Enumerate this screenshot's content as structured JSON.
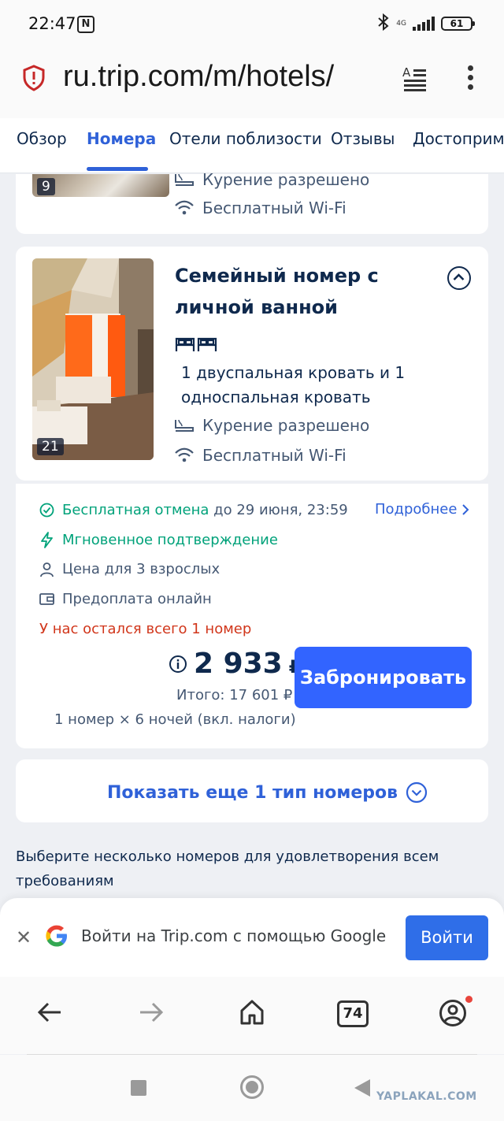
{
  "status_bar": {
    "time": "22:47",
    "nfc": "N",
    "network": "4G",
    "battery": "61"
  },
  "address_bar": {
    "url": "ru.trip.com/m/hotels/"
  },
  "tabs": [
    {
      "label": "Обзор"
    },
    {
      "label": "Номера",
      "active": true
    },
    {
      "label": "Отели поблизости"
    },
    {
      "label": "Отзывы"
    },
    {
      "label": "Достопримечательности"
    }
  ],
  "prev_room": {
    "photo_count": "9",
    "amenities": [
      "Курение разрешено",
      "Бесплатный Wi-Fi"
    ]
  },
  "room": {
    "title": "Семейный номер с личной ванной",
    "photo_count": "21",
    "beds": "1 двуспальная кровать и 1 односпальная кровать",
    "amenities": [
      "Курение разрешено",
      "Бесплатный Wi-Fi"
    ]
  },
  "offer": {
    "free_cancel_label": "Бесплатная отмена",
    "free_cancel_until": "до 29 июня, 23:59",
    "more_link": "Подробнее",
    "instant_confirm": "Мгновенное подтверждение",
    "price_for": "Цена для 3 взрослых",
    "prepay": "Предоплата онлайн",
    "warning": "У нас остался всего 1 номер",
    "price": "2 933",
    "currency": "₽",
    "total": "Итого: 17 601 ₽",
    "nights": "1 номер × 6 ночей (вкл. налоги)",
    "book_label": "Забронировать"
  },
  "show_more": {
    "label": "Показать еще 1 тип номеров"
  },
  "hint": "Выберите несколько номеров для удовлетворения всем требованиям",
  "google_signin": {
    "text": "Войти на Trip.com с помощью Google",
    "button": "Войти"
  },
  "browser_nav": {
    "tabs_count": "74"
  },
  "watermark": "YAPLAKAL.COM",
  "colors": {
    "accent": "#3264ff",
    "link": "#2f61d8",
    "green": "#00a27a",
    "warning": "#d1361b",
    "text": "#0f294d"
  }
}
